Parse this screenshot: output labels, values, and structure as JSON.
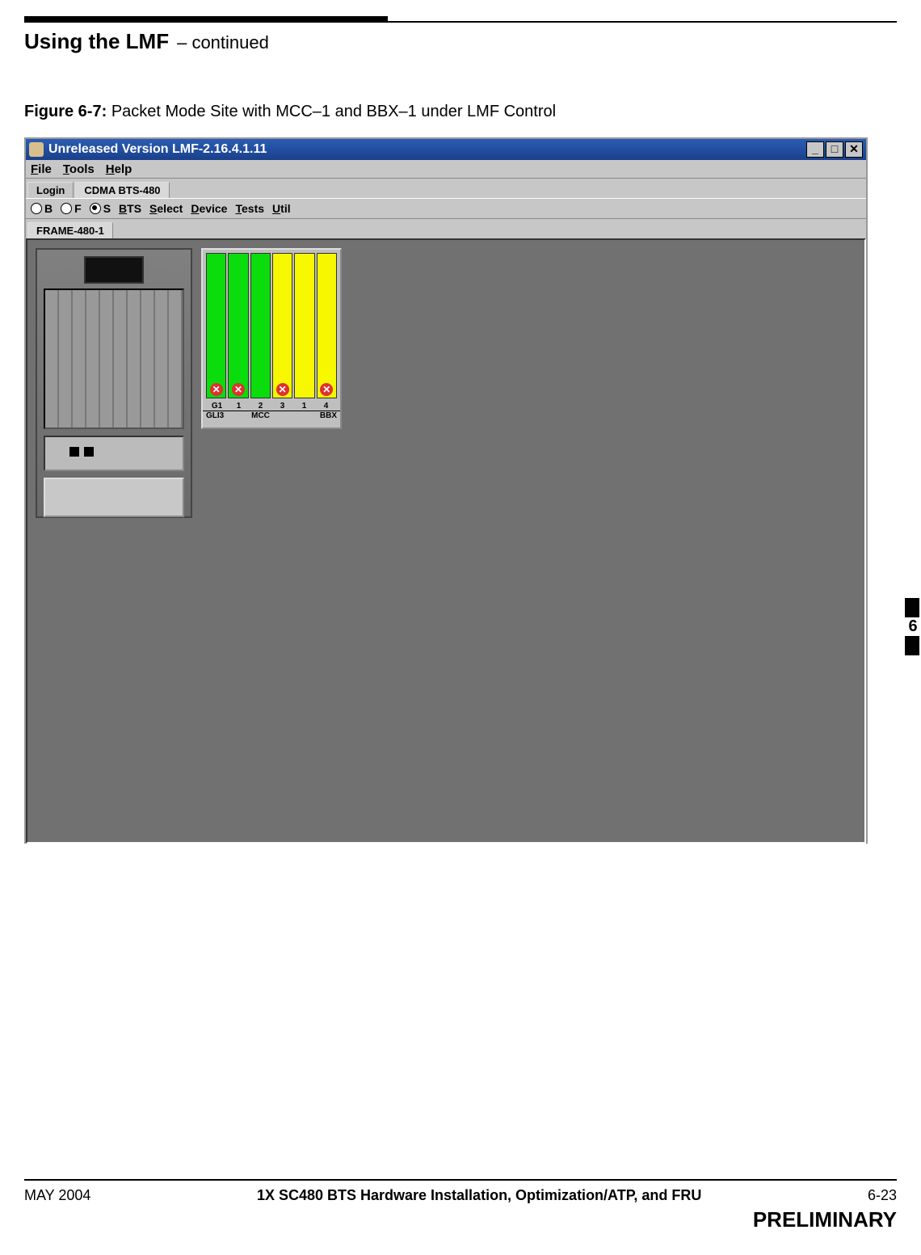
{
  "heading": {
    "title": "Using the LMF",
    "continued": "– continued"
  },
  "figure": {
    "number": "Figure 6-7:",
    "caption": "Packet Mode Site with MCC–1 and BBX–1 under LMF Control"
  },
  "app": {
    "title": "Unreleased Version LMF-2.16.4.1.11",
    "windowControls": {
      "min": "_",
      "max": "□",
      "close": "✕"
    },
    "menubar": [
      "File",
      "Tools",
      "Help"
    ],
    "tabs": {
      "login": "Login",
      "active": "CDMA BTS-480"
    },
    "toolbar": {
      "options": [
        {
          "label": "B",
          "selected": false
        },
        {
          "label": "F",
          "selected": false
        },
        {
          "label": "S",
          "selected": true
        }
      ],
      "menus": [
        "BTS",
        "Select",
        "Device",
        "Tests",
        "Util"
      ]
    },
    "frameTab": "FRAME-480-1",
    "slots": {
      "columns": [
        {
          "color": "green",
          "label": "G1",
          "hasX": true
        },
        {
          "color": "green",
          "label": "1",
          "hasX": true
        },
        {
          "color": "green",
          "label": "2",
          "hasX": false
        },
        {
          "color": "yellow",
          "label": "3",
          "hasX": true
        },
        {
          "color": "yellow",
          "label": "1",
          "hasX": false
        },
        {
          "color": "yellow",
          "label": "4",
          "hasX": true
        }
      ],
      "groups": {
        "left": "GLI3",
        "mid": "MCC",
        "right": "BBX"
      }
    }
  },
  "sideTab": "6",
  "footer": {
    "left": "MAY 2004",
    "mid": "1X SC480 BTS Hardware Installation, Optimization/ATP, and FRU",
    "right": "6-23",
    "prelim": "PRELIMINARY"
  }
}
